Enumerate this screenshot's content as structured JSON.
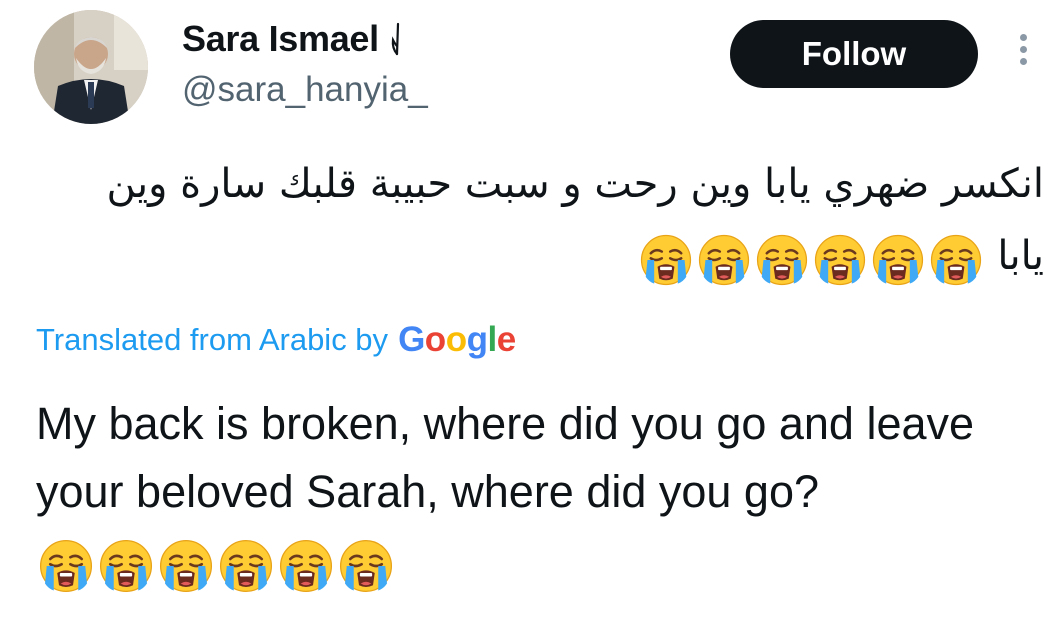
{
  "author": {
    "display_name": "Sara Ismael",
    "handle": "@sara_hanyia_"
  },
  "actions": {
    "follow_label": "Follow"
  },
  "icons": {
    "name_badge": "palestine-flag-icon",
    "more": "more-vertical-icon",
    "emoji": "loudly-crying-face-emoji"
  },
  "tweet": {
    "arabic_text": "انكسر ضهري يابا وين رحت و سبت حبيبة قلبك سارة وين يابا",
    "arabic_emoji_count": 6,
    "translated_label": "Translated from Arabic by",
    "translation_provider_letters": [
      "G",
      "o",
      "o",
      "g",
      "l",
      "e"
    ],
    "translation_text": "My back is broken, where did you go and leave your beloved Sarah, where did you go?",
    "translation_emoji_count": 6
  },
  "colors": {
    "link_blue": "#1d9bf0",
    "follow_bg": "#0f1419",
    "secondary_text": "#536471"
  }
}
